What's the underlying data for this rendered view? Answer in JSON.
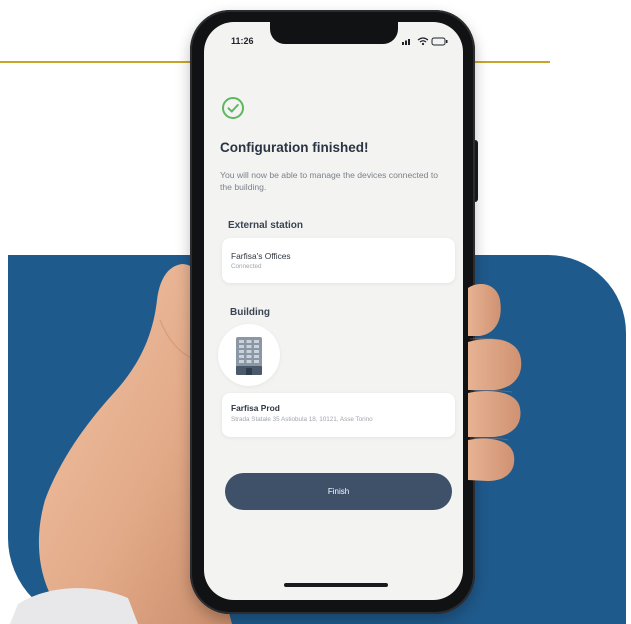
{
  "status_bar": {
    "time": "11:26"
  },
  "screen": {
    "title": "Configuration finished!",
    "description": "You will now be able to manage the devices connected to the building."
  },
  "external_station": {
    "heading": "External station",
    "name": "Farfisa's Offices",
    "status": "Connected"
  },
  "building": {
    "heading": "Building",
    "name": "Farfisa Prod",
    "address": "Strada Statale 35 Astiobula 18, 10121, Asse Torino"
  },
  "finish_button": {
    "label": "Finish"
  },
  "icons": {
    "success": "check-circle-icon",
    "building": "building-icon",
    "signal": "signal-icon",
    "wifi": "wifi-icon",
    "battery": "battery-icon"
  },
  "colors": {
    "accent_line": "#c9a42a",
    "brand_panel": "#1f5a8c",
    "button": "#3e5169",
    "success": "#5cb85c",
    "screen_background": "#f3f3f2"
  }
}
